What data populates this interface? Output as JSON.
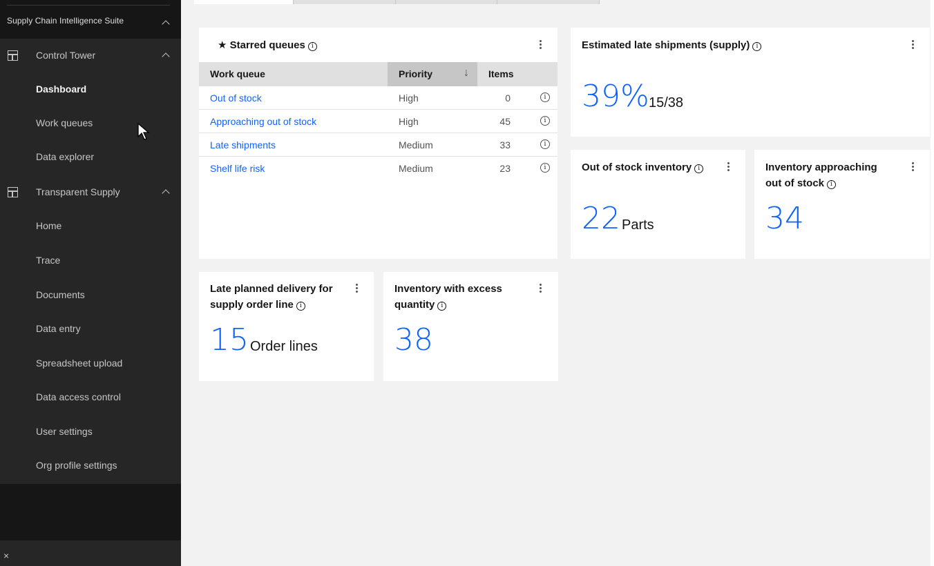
{
  "sidebar": {
    "suite_label": "Supply Chain Intelligence Suite",
    "groups": [
      {
        "label": "Control Tower",
        "items": [
          "Dashboard",
          "Work queues",
          "Data explorer"
        ]
      },
      {
        "label": "Transparent Supply",
        "items": [
          "Home",
          "Trace",
          "Documents",
          "Data entry",
          "Spreadsheet upload",
          "Data access control",
          "User settings",
          "Org profile settings"
        ]
      }
    ],
    "active_item": "Dashboard",
    "close_label": "×"
  },
  "starred": {
    "title": "Starred queues",
    "columns": [
      "Work queue",
      "Priority",
      "Items"
    ],
    "rows": [
      {
        "queue": "Out of stock",
        "priority": "High",
        "items": "0"
      },
      {
        "queue": "Approaching out of stock",
        "priority": "High",
        "items": "45"
      },
      {
        "queue": "Late shipments",
        "priority": "Medium",
        "items": "33"
      },
      {
        "queue": "Shelf life risk",
        "priority": "Medium",
        "items": "23"
      }
    ]
  },
  "late_shipments": {
    "title": "Estimated late shipments (supply)",
    "value": "39%",
    "sub": "15/38"
  },
  "out_of_stock": {
    "title": "Out of stock inventory",
    "value": "22",
    "sub": "Parts"
  },
  "approaching": {
    "title_line1": "Inventory approaching",
    "title_line2": "out of stock",
    "value": "34"
  },
  "late_delivery": {
    "title_line1": "Late planned delivery for",
    "title_line2": "supply order line",
    "value": "15",
    "sub": "Order lines"
  },
  "excess": {
    "title_line1": "Inventory with excess",
    "title_line2": "quantity",
    "value": "38"
  },
  "colors": {
    "accent": "#0f62fe",
    "sidebar_bg": "#262626",
    "sidebar_dark": "#161616",
    "canvas_bg": "#f2f2f2"
  }
}
